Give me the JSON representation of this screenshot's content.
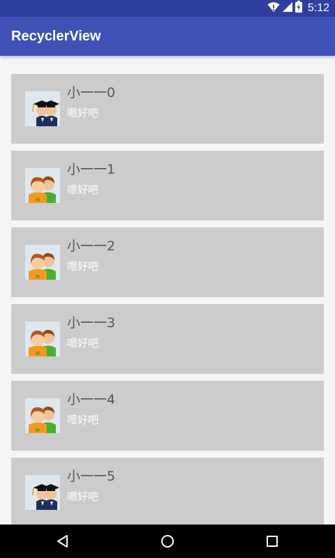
{
  "status_bar": {
    "time": "5:12",
    "icons": [
      "wifi-icon",
      "cell-signal-icon",
      "battery-charging-icon"
    ]
  },
  "app_bar": {
    "title": "RecyclerView"
  },
  "list": {
    "items": [
      {
        "name": "小一一0",
        "subtitle": "嗯好吧",
        "avatar_icon": "graduates-icon"
      },
      {
        "name": "小一一1",
        "subtitle": "嗯好吧",
        "avatar_icon": "users-icon"
      },
      {
        "name": "小一一2",
        "subtitle": "嗯好吧",
        "avatar_icon": "users-icon"
      },
      {
        "name": "小一一3",
        "subtitle": "嗯好吧",
        "avatar_icon": "users-icon"
      },
      {
        "name": "小一一4",
        "subtitle": "嗯好吧",
        "avatar_icon": "users-icon"
      },
      {
        "name": "小一一5",
        "subtitle": "嗯好吧",
        "avatar_icon": "graduates-icon"
      }
    ]
  },
  "nav_bar": {
    "buttons": [
      "back-icon",
      "home-icon",
      "recents-icon"
    ]
  },
  "colors": {
    "status_bar": "#303f9f",
    "app_bar": "#3f51b5",
    "item_background": "#cccccc",
    "page_background": "#f5f5f5"
  }
}
